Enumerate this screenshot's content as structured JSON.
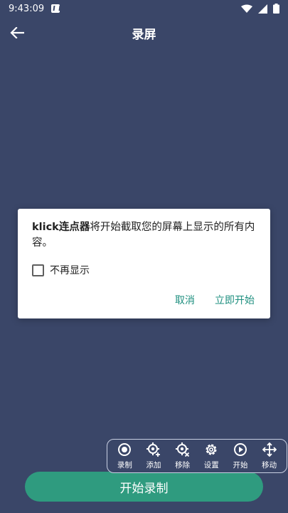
{
  "status": {
    "time": "9:43:09"
  },
  "app_bar": {
    "title": "录屏"
  },
  "dialog": {
    "app_name": "klick连点器",
    "message": "将开始截取您的屏幕上显示的所有内容。",
    "checkbox_label": "不再显示",
    "cancel_label": "取消",
    "confirm_label": "立即开始"
  },
  "toolbar": {
    "items": [
      {
        "label": "录制",
        "icon": "record-icon"
      },
      {
        "label": "添加",
        "icon": "add-target-icon"
      },
      {
        "label": "移除",
        "icon": "remove-target-icon"
      },
      {
        "label": "设置",
        "icon": "gear-icon"
      },
      {
        "label": "开始",
        "icon": "play-icon"
      },
      {
        "label": "移动",
        "icon": "move-icon"
      }
    ]
  },
  "start_button": {
    "label": "开始录制"
  },
  "colors": {
    "background": "#3a4668",
    "accent": "#2f9b7f",
    "dialog_action": "#1e8f7f"
  }
}
